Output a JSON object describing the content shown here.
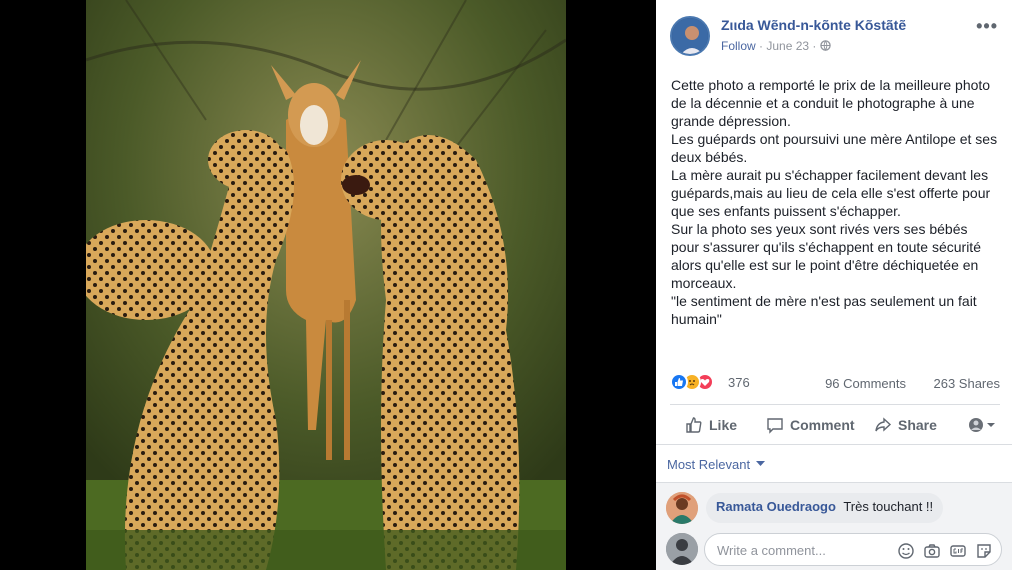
{
  "post": {
    "author": "Zιιda Wẽnd-n-kõnte Kõstãtẽ",
    "follow_label": "Follow",
    "date": "June 23",
    "separator": "·",
    "more_label": "•••",
    "text_lines": [
      "Cette photo a remporté le prix de la meilleure photo",
      "de la décennie et a conduit le photographe à une",
      "grande dépression.",
      "Les guépards ont poursuivi une mère Antilope et ses",
      "deux bébés.",
      "La mère aurait pu s'échapper facilement devant les",
      "guépards,mais au lieu de cela elle s'est offerte pour",
      "que ses enfants puissent s'échapper.",
      "Sur la photo ses yeux sont rivés vers ses bébés",
      "pour s'assurer qu'ils s'échappent en toute sécurité",
      "alors qu'elle est sur le point d'être déchiquetée en",
      "morceaux.",
      "\"le sentiment de mère n'est pas seulement un fait",
      "humain\""
    ]
  },
  "stats": {
    "reaction_count": "376",
    "comments": "96 Comments",
    "shares": "263 Shares",
    "reaction_icons": [
      "like-icon",
      "sad-icon",
      "love-icon"
    ]
  },
  "actions": {
    "like": "Like",
    "comment": "Comment",
    "share": "Share"
  },
  "sort": {
    "label": "Most Relevant"
  },
  "comment": {
    "name": "Ramata Ouedraogo",
    "text": "Très touchant !!"
  },
  "write": {
    "placeholder": "Write a comment..."
  },
  "colors": {
    "link": "#385898",
    "like_blue": "#1877f2",
    "love_red": "#f33e58",
    "sad_yellow": "#f7b125"
  }
}
